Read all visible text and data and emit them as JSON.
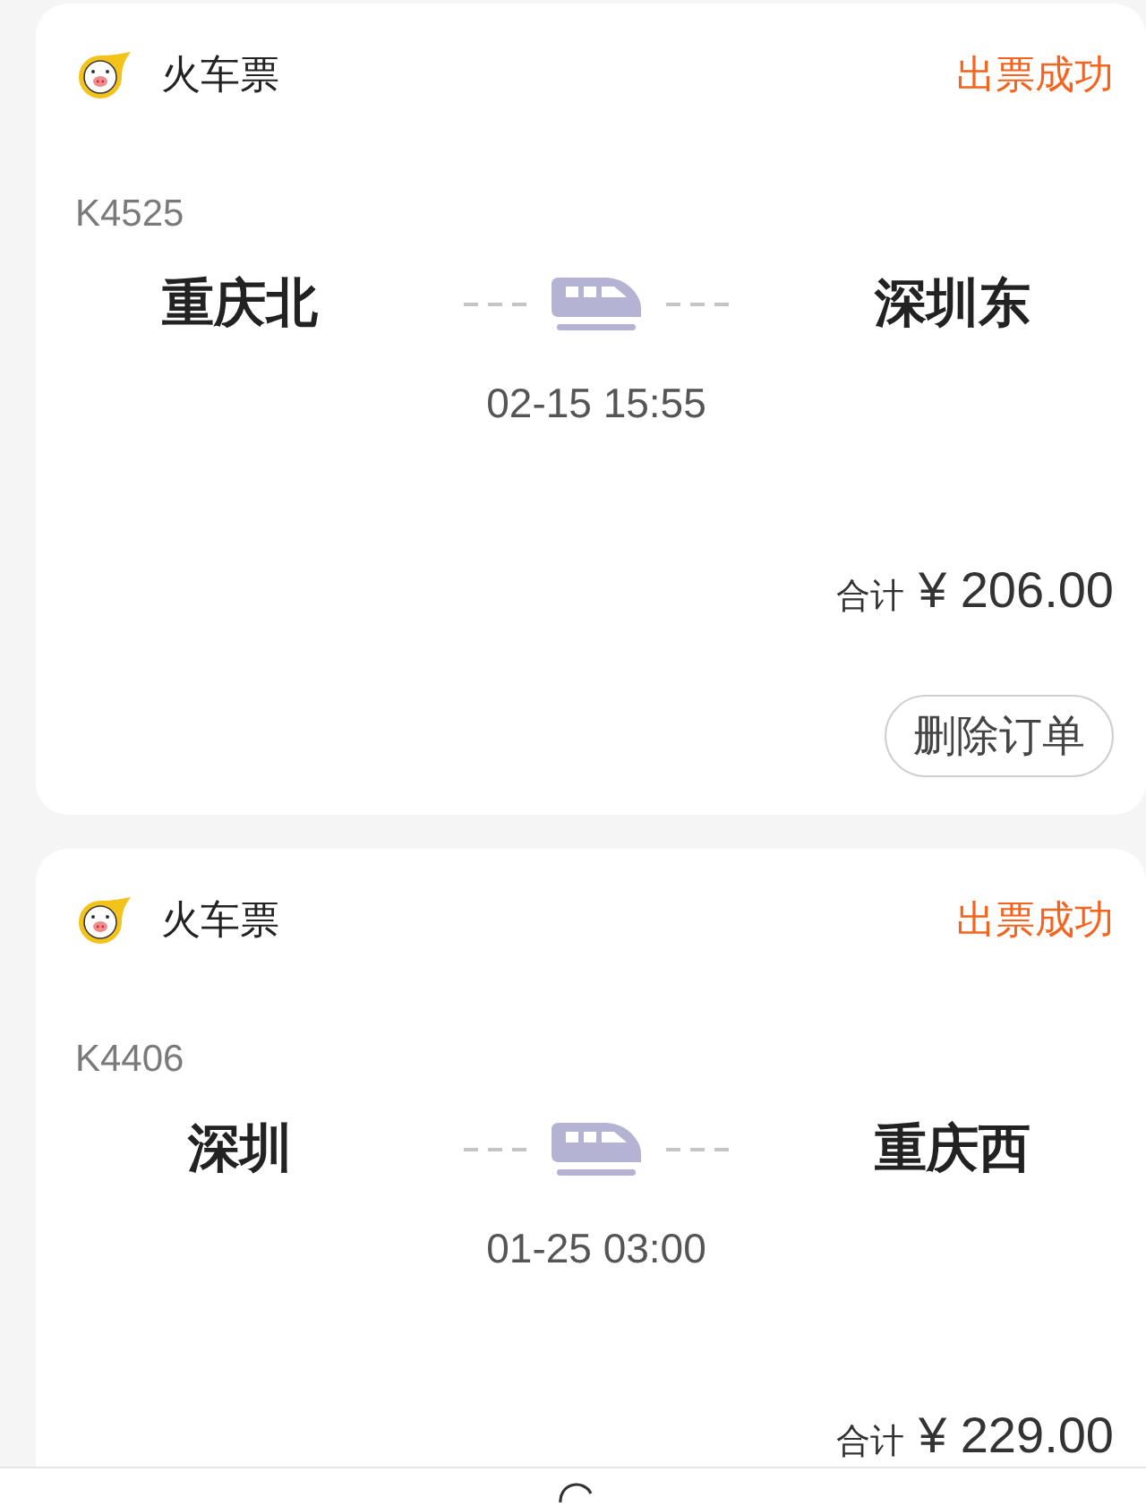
{
  "orders": [
    {
      "category": "火车票",
      "status": "出票成功",
      "train_no": "K4525",
      "from": "重庆北",
      "to": "深圳东",
      "departure": "02-15 15:55",
      "total_label": "合计",
      "total": "¥ 206.00",
      "button": "删除订单"
    },
    {
      "category": "火车票",
      "status": "出票成功",
      "train_no": "K4406",
      "from": "深圳",
      "to": "重庆西",
      "departure": "01-25 03:00",
      "total_label": "合计",
      "total": "¥ 229.00"
    }
  ]
}
